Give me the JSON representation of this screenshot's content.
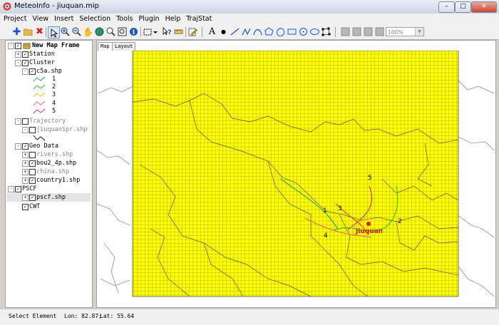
{
  "window": {
    "title": "MeteoInfo - jiuquan.mip",
    "minimize": "–",
    "maximize": "□",
    "close": "✕"
  },
  "menu": [
    "Project",
    "View",
    "Insert",
    "Selection",
    "Tools",
    "Plugin",
    "Help",
    "TrajStat"
  ],
  "toolbar": {
    "zoom_value": "100%"
  },
  "legend": {
    "root": "New Map Frame",
    "station": "Station",
    "cluster": "Cluster",
    "c5a": "c5a.shp",
    "clusters": [
      {
        "label": "1",
        "color": "#2ca36b"
      },
      {
        "label": "2",
        "color": "#22c322"
      },
      {
        "label": "3",
        "color": "#d8c82a"
      },
      {
        "label": "4",
        "color": "#e86a6a"
      },
      {
        "label": "5",
        "color": "#e0306a"
      }
    ],
    "trajectory": "Trajectory",
    "traj_layer": "jiuquanSpr.shp",
    "geodata": "Geo Data",
    "rivers": "rivers.shp",
    "bou2": "bou2_4p.shp",
    "china": "china.shp",
    "country": "country1.shp",
    "pscf": "PSCF",
    "pscf_layer": "pscf.shp",
    "cwt": "CWT"
  },
  "tabs": {
    "map": "Map",
    "layout": "Layout"
  },
  "map": {
    "grid_color": "#ffff00",
    "grid_line_color": "#6b6b2a",
    "station_label": "Jiuquan",
    "station_color": "#e01818",
    "traj_labels": [
      "1",
      "2",
      "3",
      "4",
      "5"
    ]
  },
  "status": {
    "mode": "Select Element",
    "lon": "Lon: 82.87;",
    "lat": "Lat: 55.64"
  }
}
